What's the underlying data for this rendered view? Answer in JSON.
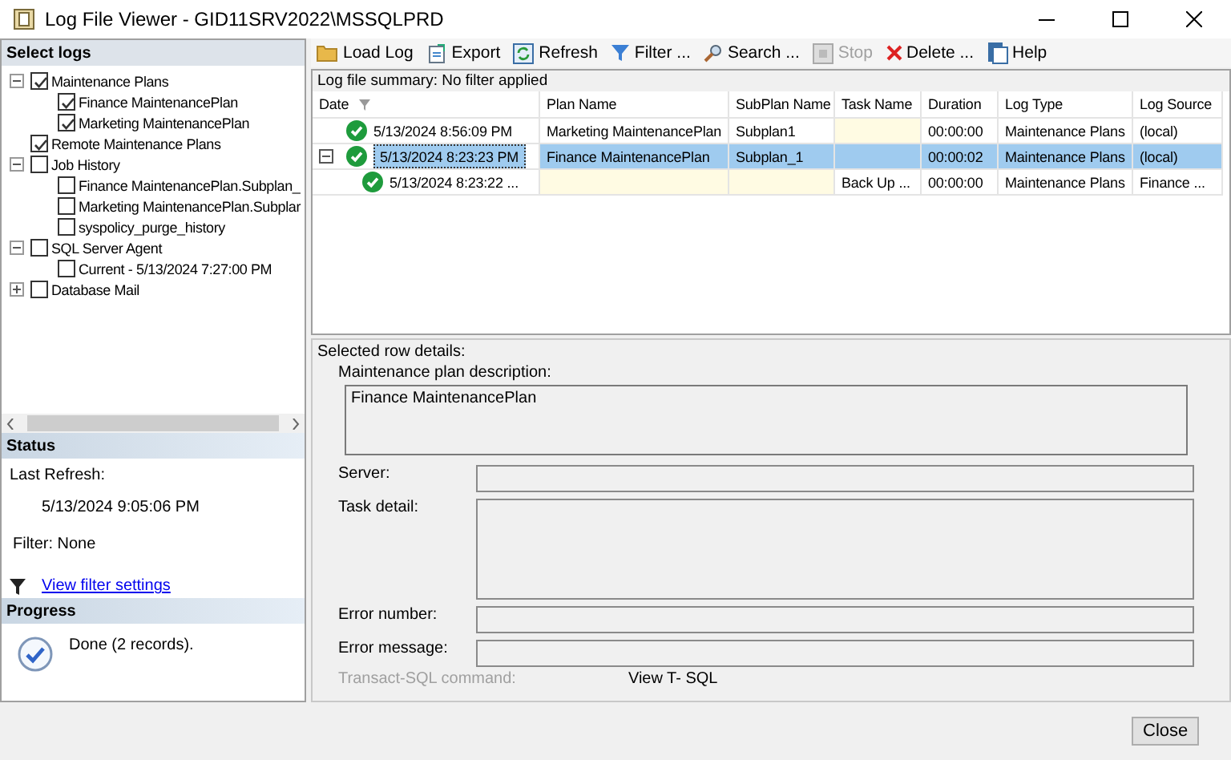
{
  "window": {
    "title": "Log File Viewer - GID11SRV2022\\MSSQLPRD"
  },
  "select_logs": {
    "title": "Select logs",
    "tree": [
      {
        "label": "Maintenance Plans",
        "checked": true,
        "expanded": true,
        "children": [
          {
            "label": "Finance MaintenancePlan",
            "checked": true
          },
          {
            "label": "Marketing MaintenancePlan",
            "checked": true
          }
        ]
      },
      {
        "label": "Remote Maintenance Plans",
        "checked": true
      },
      {
        "label": "Job History",
        "checked": false,
        "expanded": true,
        "children": [
          {
            "label": "Finance MaintenancePlan.Subplan_",
            "checked": false
          },
          {
            "label": "Marketing MaintenancePlan.Subplar",
            "checked": false
          },
          {
            "label": "syspolicy_purge_history",
            "checked": false
          }
        ]
      },
      {
        "label": "SQL Server Agent",
        "checked": false,
        "expanded": true,
        "children": [
          {
            "label": "Current - 5/13/2024 7:27:00 PM",
            "checked": false
          }
        ]
      },
      {
        "label": "Database Mail",
        "checked": false,
        "expanded": false
      }
    ]
  },
  "status": {
    "title": "Status",
    "last_refresh_label": "Last Refresh:",
    "last_refresh": "5/13/2024 9:05:06 PM",
    "filter": "Filter: None",
    "filter_link": "View filter settings"
  },
  "progress": {
    "title": "Progress",
    "message": "Done (2 records)."
  },
  "toolbar": [
    {
      "label": "Load Log",
      "kind": "folder",
      "disabled": false
    },
    {
      "label": "Export",
      "kind": "export",
      "disabled": false
    },
    {
      "label": "Refresh",
      "kind": "refresh",
      "disabled": false
    },
    {
      "label": "Filter ...",
      "kind": "filter",
      "disabled": false
    },
    {
      "label": "Search ...",
      "kind": "search",
      "disabled": false
    },
    {
      "label": "Stop",
      "kind": "stop",
      "disabled": true
    },
    {
      "label": "Delete ...",
      "kind": "delete",
      "disabled": false
    },
    {
      "label": "Help",
      "kind": "help",
      "disabled": false
    }
  ],
  "log_grid": {
    "summary": "Log file summary: No filter applied",
    "columns": [
      "Date",
      "Plan Name",
      "SubPlan Name",
      "Task Name",
      "Duration",
      "Log Type",
      "Log Source"
    ],
    "rows": [
      {
        "selected": false,
        "cells": [
          "5/13/2024 8:56:09 PM",
          "Marketing MaintenancePlan",
          "Subplan1",
          "",
          "00:00:00",
          "Maintenance Plans",
          "(local)"
        ]
      },
      {
        "selected": true,
        "expanded": true,
        "cells": [
          "5/13/2024 8:23:23 PM",
          "Finance MaintenancePlan",
          "Subplan_1",
          "",
          "00:00:02",
          "Maintenance Plans",
          "(local)"
        ],
        "children": [
          {
            "selected": false,
            "cells": [
              "5/13/2024 8:23:22 ...",
              "",
              "",
              "Back Up ...",
              "00:00:00",
              "Maintenance Plans",
              "Finance ..."
            ]
          }
        ]
      }
    ]
  },
  "details": {
    "title": "Selected row details:",
    "fields": [
      {
        "kind": "description",
        "label": "Maintenance plan description:",
        "value": "Finance MaintenancePlan"
      },
      {
        "kind": "line",
        "label": "Server:"
      },
      {
        "kind": "area",
        "label": "Task detail:"
      },
      {
        "kind": "line",
        "label": "Error number:"
      },
      {
        "kind": "line",
        "label": "Error message:"
      }
    ],
    "tsql": {
      "label": "Transact-SQL command:",
      "disabled": true,
      "link": "View T- SQL"
    }
  },
  "buttons": [
    "Close"
  ]
}
